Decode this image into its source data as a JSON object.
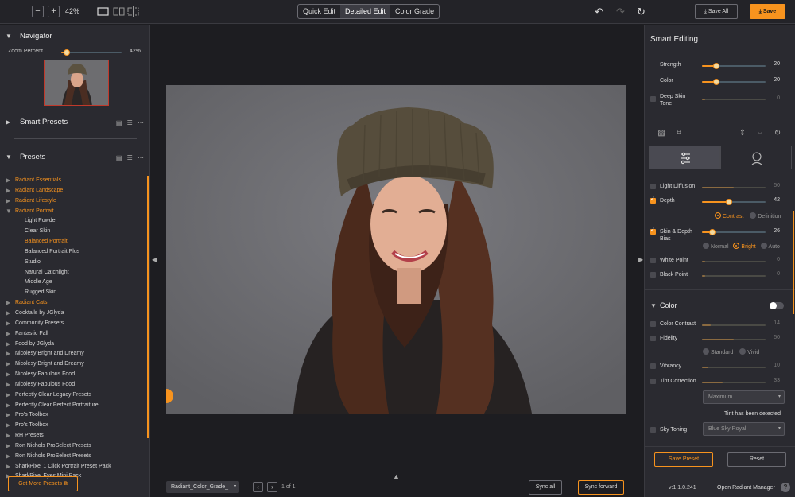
{
  "topbar": {
    "zoom_out": "−",
    "zoom_in": "+",
    "zoom_level": "42%",
    "modes": [
      "Quick Edit",
      "Detailed Edit",
      "Color Grade"
    ],
    "active_mode": "Detailed Edit",
    "save_all": "Save All",
    "save": "Save"
  },
  "navigator": {
    "title": "Navigator",
    "zoom_label": "Zoom Percent",
    "zoom_value": "42%",
    "zoom_fraction": 0.1
  },
  "smart_presets": {
    "title": "Smart Presets"
  },
  "presets": {
    "title": "Presets",
    "items": [
      {
        "name": "Radiant Essentials",
        "orange": true,
        "sub": false,
        "open": false
      },
      {
        "name": "Radiant Landscape",
        "orange": true,
        "sub": false,
        "open": false
      },
      {
        "name": "Radiant Lifestyle",
        "orange": true,
        "sub": false,
        "open": false
      },
      {
        "name": "Radiant Portrait",
        "orange": true,
        "sub": false,
        "open": true
      },
      {
        "name": "Light Powder",
        "orange": false,
        "sub": true
      },
      {
        "name": "Clear Skin",
        "orange": false,
        "sub": true
      },
      {
        "name": "Balanced Portrait",
        "orange": true,
        "sub": true
      },
      {
        "name": "Balanced Portrait Plus",
        "orange": false,
        "sub": true
      },
      {
        "name": "Studio",
        "orange": false,
        "sub": true
      },
      {
        "name": "Natural Catchlight",
        "orange": false,
        "sub": true
      },
      {
        "name": "Middle Age",
        "orange": false,
        "sub": true
      },
      {
        "name": "Rugged Skin",
        "orange": false,
        "sub": true
      },
      {
        "name": "Radiant Cats",
        "orange": true,
        "sub": false,
        "open": false
      },
      {
        "name": "Cocktails by JGlyda",
        "orange": false,
        "sub": false,
        "open": false
      },
      {
        "name": "Community Presets",
        "orange": false,
        "sub": false,
        "open": false
      },
      {
        "name": "Fantastic Fall",
        "orange": false,
        "sub": false,
        "open": false
      },
      {
        "name": "Food by JGlyda",
        "orange": false,
        "sub": false,
        "open": false
      },
      {
        "name": "Nicolesy Bright and Dreamy",
        "orange": false,
        "sub": false,
        "open": false
      },
      {
        "name": "Nicolesy Bright and Dreamy",
        "orange": false,
        "sub": false,
        "open": false
      },
      {
        "name": "Nicolesy Fabulous Food",
        "orange": false,
        "sub": false,
        "open": false
      },
      {
        "name": "Nicolesy Fabulous Food",
        "orange": false,
        "sub": false,
        "open": false
      },
      {
        "name": "Perfectly Clear Legacy Presets",
        "orange": false,
        "sub": false,
        "open": false
      },
      {
        "name": "Perfectly Clear Perfect Portraiture",
        "orange": false,
        "sub": false,
        "open": false
      },
      {
        "name": "Pro's Toolbox",
        "orange": false,
        "sub": false,
        "open": false
      },
      {
        "name": "Pro's Toolbox",
        "orange": false,
        "sub": false,
        "open": false
      },
      {
        "name": "RH Presets",
        "orange": false,
        "sub": false,
        "open": false
      },
      {
        "name": "Ron Nichols ProSelect Presets",
        "orange": false,
        "sub": false,
        "open": false
      },
      {
        "name": "Ron Nichols ProSelect Presets",
        "orange": false,
        "sub": false,
        "open": false
      },
      {
        "name": "SharkPixel 1 Click Portrait Preset Pack",
        "orange": false,
        "sub": false,
        "open": false
      },
      {
        "name": "SharkPixel Eyes Mini Pack",
        "orange": false,
        "sub": false,
        "open": false
      }
    ],
    "get_more": "Get More Presets"
  },
  "bottom": {
    "file_name": "Radiant_Color_Grade_",
    "page": "1 of 1",
    "sync_all": "Sync all",
    "sync_forward": "Sync forward"
  },
  "smart_editing": {
    "title": "Smart Editing",
    "strength_label": "Strength",
    "strength_value": "20",
    "color_label": "Color",
    "color_value": "20",
    "deep_skin_label": "Deep Skin\nTone",
    "deep_skin_value": "0"
  },
  "adjust": {
    "light_diffusion_label": "Light Diffusion",
    "light_diffusion_value": "50",
    "depth_label": "Depth",
    "depth_value": "42",
    "depth_opt_contrast": "Contrast",
    "depth_opt_definition": "Definition",
    "skin_depth_label": "Skin & Depth\nBias",
    "skin_depth_value": "26",
    "bias_normal": "Normal",
    "bias_bright": "Bright",
    "bias_auto": "Auto",
    "white_point_label": "White Point",
    "white_point_value": "0",
    "black_point_label": "Black Point",
    "black_point_value": "0"
  },
  "color_section": {
    "title": "Color",
    "contrast_label": "Color Contrast",
    "contrast_value": "14",
    "fidelity_label": "Fidelity",
    "fidelity_value": "50",
    "fid_standard": "Standard",
    "fid_vivid": "Vivid",
    "vibrancy_label": "Vibrancy",
    "vibrancy_value": "10",
    "tint_label": "Tint Correction",
    "tint_value": "33",
    "tint_mode": "Maximum",
    "tint_note": "Tint has been detected",
    "sky_label": "Sky Toning",
    "sky_value": "Blue Sky Royal"
  },
  "footer": {
    "save_preset": "Save Preset",
    "reset": "Reset",
    "version": "v:1.1.0.241",
    "manager": "Open Radiant Manager",
    "help": "?"
  },
  "colors": {
    "accent": "#f7931e",
    "panel": "#2a2a30",
    "canvas": "#1d1d21"
  }
}
